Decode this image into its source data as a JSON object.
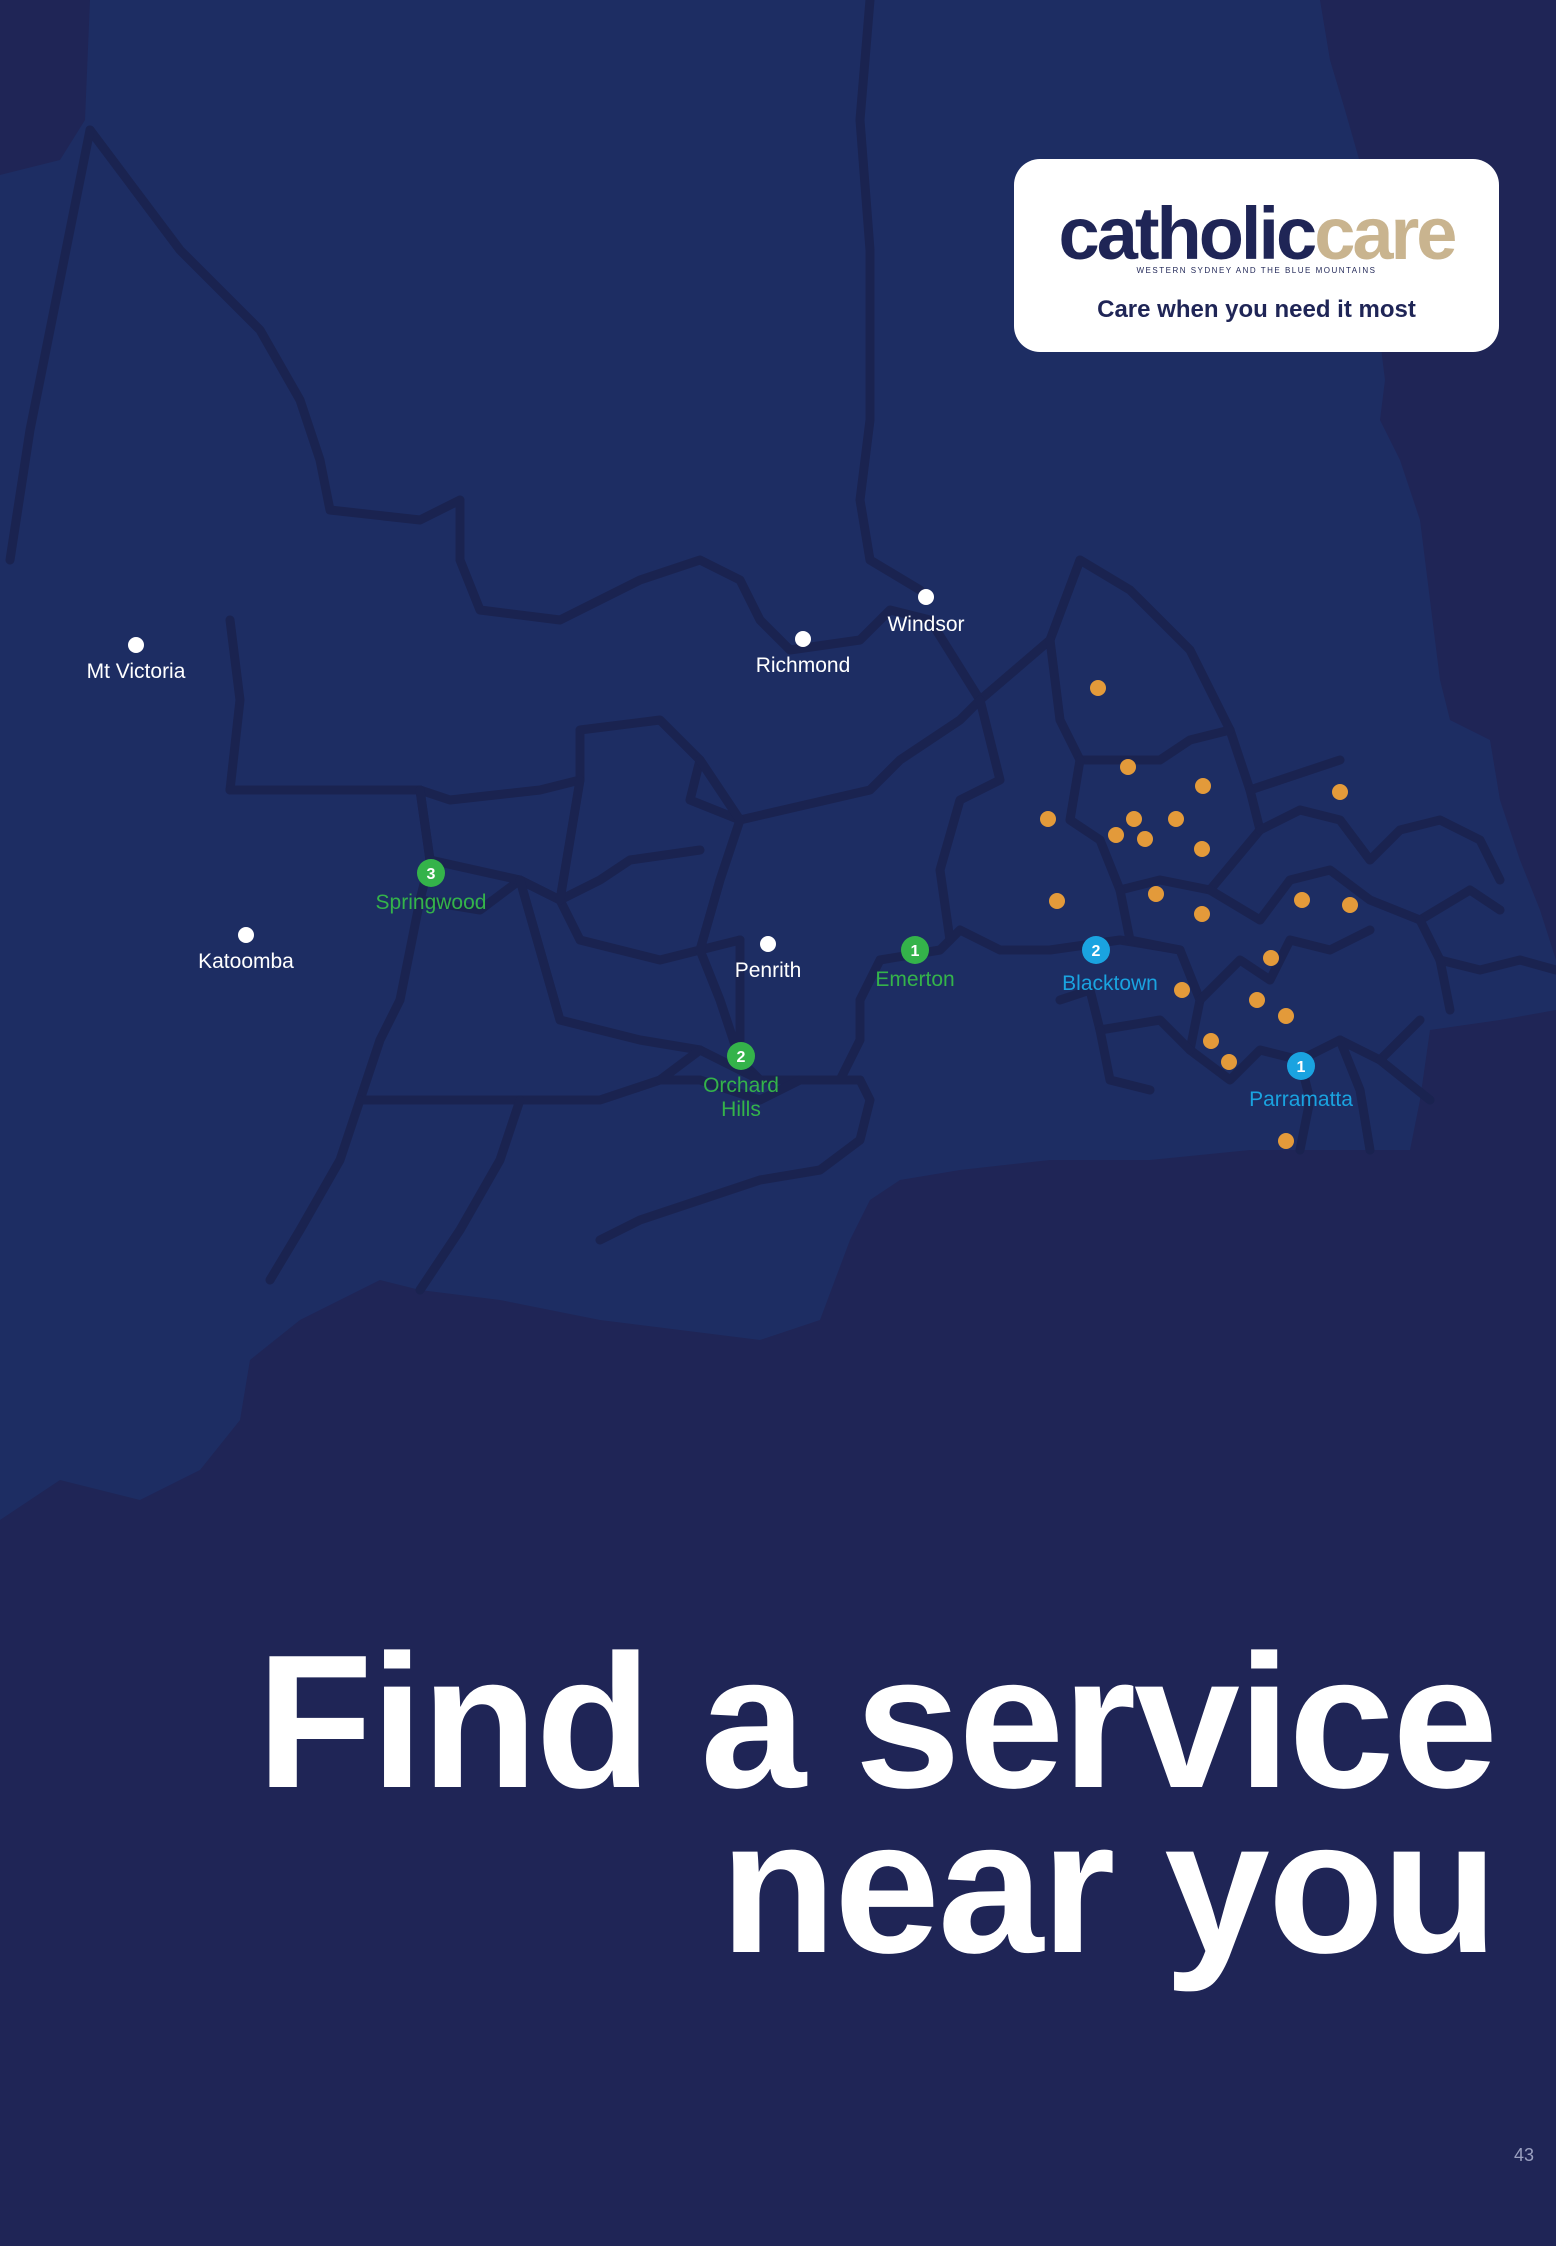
{
  "logo": {
    "brand_dark": "catholic",
    "brand_light": "care",
    "subtitle": "WESTERN SYDNEY AND THE BLUE MOUNTAINS",
    "tagline": "Care when you need it most"
  },
  "headline": {
    "line1": "Find a service",
    "line2": "near you"
  },
  "page_number": "43",
  "colors": {
    "background": "#1f2556",
    "map_land": "#1d2d63",
    "map_borders": "#1a2350",
    "green": "#34b34a",
    "blue": "#1aa3e0",
    "orange": "#e39a3a",
    "brand_gold": "#c9b48f"
  },
  "map": {
    "towns": [
      "Windsor",
      "Richmond",
      "Mt Victoria",
      "Katoomba",
      "Penrith"
    ],
    "green_services": [
      {
        "num": "1",
        "name": "Emerton"
      },
      {
        "num": "2",
        "name_line1": "Orchard",
        "name_line2": "Hills"
      },
      {
        "num": "3",
        "name": "Springwood"
      }
    ],
    "blue_services": [
      {
        "num": "1",
        "name": "Parramatta"
      },
      {
        "num": "2",
        "name": "Blacktown"
      }
    ]
  }
}
